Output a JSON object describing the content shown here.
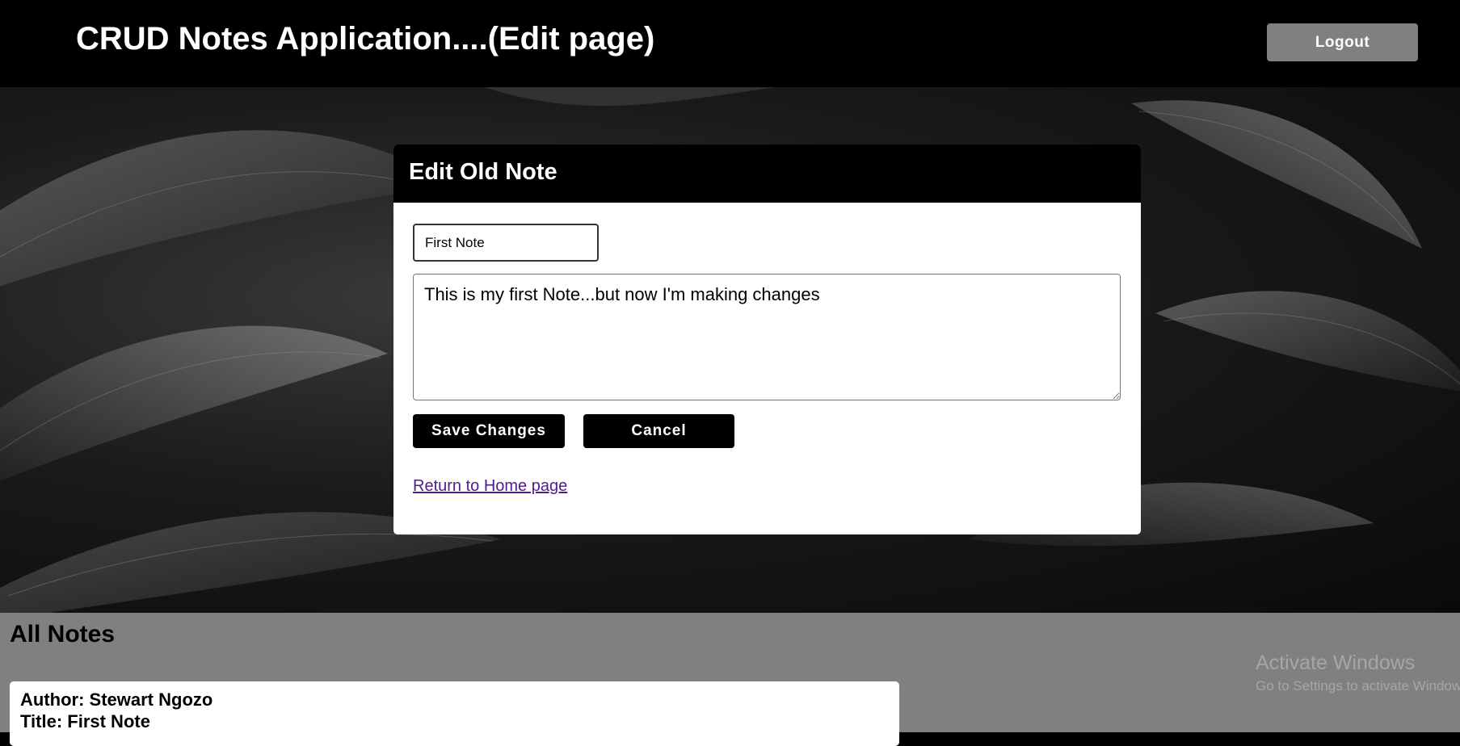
{
  "header": {
    "title": "CRUD Notes Application....(Edit page)",
    "logout_label": "Logout"
  },
  "edit_card": {
    "heading": "Edit Old Note",
    "title_value": "First Note",
    "body_value": "This is my first Note...but now I'm making changes",
    "save_label": "Save Changes",
    "cancel_label": "Cancel",
    "home_link_label": "Return to Home page"
  },
  "notes": {
    "heading": "All Notes",
    "items": [
      {
        "author": "Author: Stewart Ngozo",
        "title": "Title: First Note"
      }
    ]
  },
  "watermark": {
    "line1": "Activate Windows",
    "line2": "Go to Settings to activate Windows."
  },
  "colors": {
    "header_bg": "#000000",
    "logout_bg": "#808080",
    "notes_bg": "#808080",
    "link": "#551a8b"
  }
}
